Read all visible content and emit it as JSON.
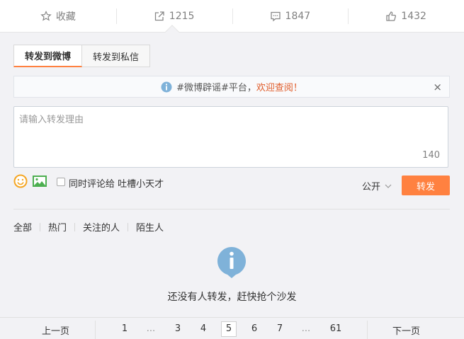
{
  "actions": [
    {
      "label": "收藏",
      "icon": "star-icon"
    },
    {
      "label": "1215",
      "icon": "share-icon"
    },
    {
      "label": "1847",
      "icon": "comment-icon"
    },
    {
      "label": "1432",
      "icon": "like-icon"
    }
  ],
  "tabs": [
    {
      "label": "转发到微博",
      "active": true
    },
    {
      "label": "转发到私信",
      "active": false
    }
  ],
  "notice": {
    "text": "#微博辟谣#平台，",
    "link": "欢迎查阅！",
    "close": "×"
  },
  "composer": {
    "placeholder": "请输入转发理由",
    "counter": "140",
    "checkbox_label": "同时评论给 吐槽小天才",
    "visibility": "公开",
    "submit": "转发"
  },
  "filters": [
    "全部",
    "热门",
    "关注的人",
    "陌生人"
  ],
  "empty": {
    "text": "还没有人转发，赶快抢个沙发"
  },
  "pager": {
    "prev": "上一页",
    "next": "下一页",
    "pages": [
      "1",
      "...",
      "3",
      "4",
      "5",
      "6",
      "7",
      "...",
      "61"
    ],
    "current": "5"
  },
  "colors": {
    "accent": "#ff8140",
    "link": "#e05c2a",
    "info": "#7fb2d9"
  }
}
